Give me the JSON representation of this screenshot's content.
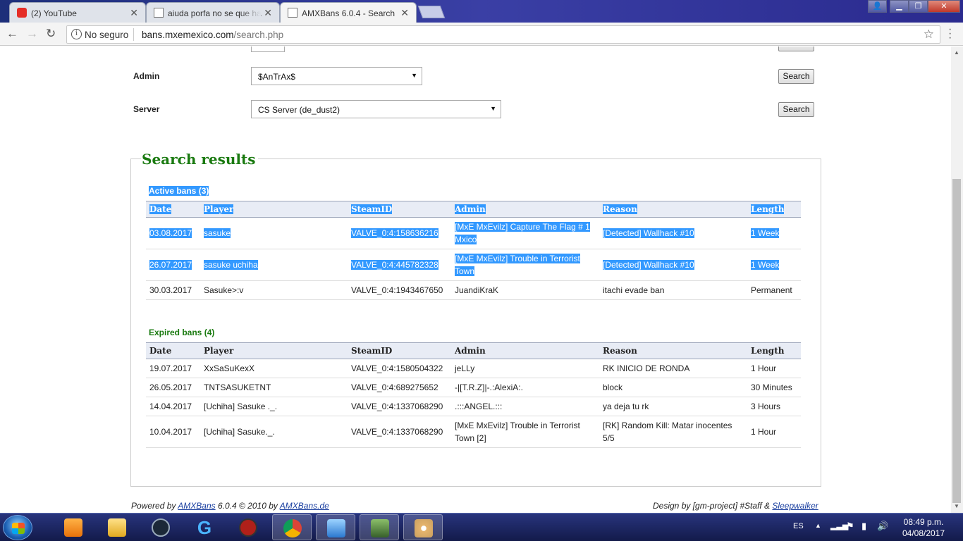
{
  "browser": {
    "tabs": [
      {
        "title": "(2) YouTube"
      },
      {
        "title": "aiuda porfa no se que ha"
      },
      {
        "title": "AMXBans 6.0.4 - Search"
      }
    ],
    "security_label": "No seguro",
    "url_host": "bans.mxemexico.com",
    "url_path": "/search.php"
  },
  "filters": {
    "admin_label": "Admin",
    "admin_value": "$AnTrAx$",
    "server_label": "Server",
    "server_value": "CS Server (de_dust2)",
    "search_label": "Search"
  },
  "results": {
    "title": "Search results",
    "active_title": "Active bans (3)",
    "expired_title": "Expired bans (4)",
    "columns": [
      "Date",
      "Player",
      "SteamID",
      "Admin",
      "Reason",
      "Length"
    ],
    "active": [
      {
        "date": "03.08.2017",
        "player": "sasuke",
        "steamid": "VALVE_0:4:158636216",
        "admin": "[MxE MxEvilz] Capture The Flag # 1 Mxico",
        "reason": "[Detected] Wallhack #10",
        "length": "1 Week",
        "selected": true
      },
      {
        "date": "26.07.2017",
        "player": "sasuke uchiha",
        "steamid": "VALVE_0:4:445782328",
        "admin": "[MxE MxEvilz] Trouble in Terrorist Town",
        "reason": "[Detected] Wallhack #10",
        "length": "1 Week",
        "selected": true
      },
      {
        "date": "30.03.2017",
        "player": "Sasuke>:v",
        "steamid": "VALVE_0:4:1943467650",
        "admin": "JuandiKraK",
        "reason": "itachi evade ban",
        "length": "Permanent",
        "selected": false
      }
    ],
    "expired": [
      {
        "date": "19.07.2017",
        "player": "XxSaSuKexX",
        "steamid": "VALVE_0:4:1580504322",
        "admin": "jeLLy",
        "reason": "RK INICIO DE RONDA",
        "length": "1 Hour"
      },
      {
        "date": "26.05.2017",
        "player": "TNTSASUKETNT",
        "steamid": "VALVE_0:4:689275652",
        "admin": "-|[T.R.Z]|-.:AlexiA:.",
        "reason": "block",
        "length": "30 Minutes"
      },
      {
        "date": "14.04.2017",
        "player": "[Uchiha] Sasuke ._.",
        "steamid": "VALVE_0:4:1337068290",
        "admin": ".:::ANGEL.:::",
        "reason": "ya deja tu rk",
        "length": "3 Hours"
      },
      {
        "date": "10.04.2017",
        "player": "[Uchiha] Sasuke._.",
        "steamid": "VALVE_0:4:1337068290",
        "admin": "[MxE MxEvilz] Trouble in Terrorist Town [2]",
        "reason": "[RK] Random Kill: Matar inocentes 5/5",
        "length": "1 Hour"
      }
    ]
  },
  "footer": {
    "powered_prefix": "Powered by",
    "powered_link": "AMXBans",
    "powered_mid": "6.0.4 © 2010 by",
    "powered_link2": "AMXBans.de",
    "design_prefix": "Design by [gm-project] #Staff &",
    "design_link": "Sleepwalker"
  },
  "taskbar": {
    "language": "ES",
    "time": "08:49 p.m.",
    "date": "04/08/2017"
  }
}
